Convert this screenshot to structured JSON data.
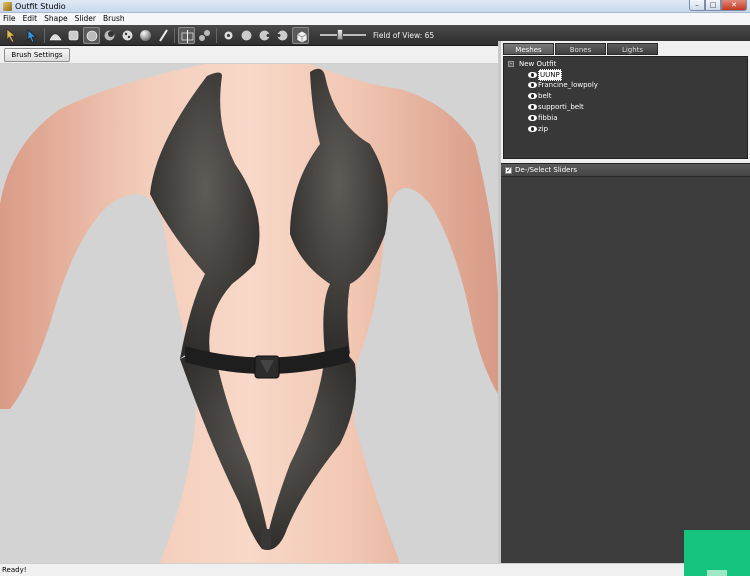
{
  "window": {
    "title": "Outfit Studio"
  },
  "menu": [
    "File",
    "Edit",
    "Shape",
    "Slider",
    "Brush"
  ],
  "toolbar": {
    "fov_label": "Field of View: 65",
    "fov_value": 65,
    "icons": [
      "select-icon",
      "move-icon",
      "inflate-brush-icon",
      "deflate-brush-icon",
      "smooth-brush-icon",
      "mask-brush-icon",
      "undiff-brush-icon",
      "weight-brush-icon",
      "paint-brush-icon",
      "symmetry-icon",
      "connected-icon",
      "brush-size-icon",
      "brush-strength-icon",
      "brush-focus-icon",
      "brush-spacing-icon",
      "view-cube-icon"
    ]
  },
  "brush_settings_label": "Brush Settings >>",
  "tabs": [
    {
      "label": "Meshes",
      "selected": true
    },
    {
      "label": "Bones",
      "selected": false
    },
    {
      "label": "Lights",
      "selected": false
    }
  ],
  "mesh_tree": {
    "root": "New Outfit",
    "expander": "-",
    "items": [
      {
        "label": "UUNP",
        "selected": true
      },
      {
        "label": "Francine_lowpoly",
        "selected": false
      },
      {
        "label": "belt",
        "selected": false
      },
      {
        "label": "supporti_belt",
        "selected": false
      },
      {
        "label": "fibbia",
        "selected": false
      },
      {
        "label": "zip",
        "selected": false
      }
    ]
  },
  "sliders_header": "De-/Select Sliders",
  "status": "Ready!",
  "colors": {
    "viewport_bg": "#d2d3d2",
    "panel_dark": "#383838",
    "accent_green": "#17c47e"
  }
}
